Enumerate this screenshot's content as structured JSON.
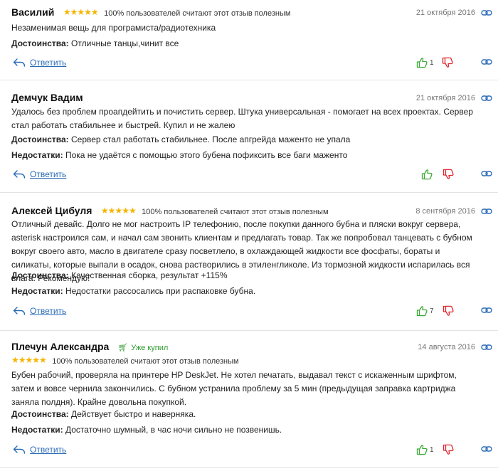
{
  "reviews": [
    {
      "name": "Василий",
      "rating": 5,
      "helpful": "100% пользователей считают этот отзыв полезным",
      "date": "21 октября 2016",
      "body": "Незаменимая вещь для програмиста/радиотехника",
      "pros_label": "Достоинства:",
      "pros": "Отличные танцы,чинит все",
      "reply": "Ответить",
      "likes": "1"
    },
    {
      "name": "Демчук Вадим",
      "date": "21 октября 2016",
      "body": "Удалось без проблем проапдейтить и почистить сервер. Штука универсальная - помогает на всех проектах. Сервер стал работать стабильнее и быстрей. Купил и не жалею",
      "pros_label": "Достоинства:",
      "pros": "Сервер стал работать стабильнее. После апгрейда маженто не упала",
      "cons_label": "Недостатки:",
      "cons": "Пока не удаётся с помощью этого бубена пофиксить все баги маженто",
      "reply": "Ответить"
    },
    {
      "name": "Алексей Цибуля",
      "rating": 5,
      "helpful": "100% пользователей считают этот отзыв полезным",
      "date": "8 сентября 2016",
      "body": "Отличный девайс. Долго не мог настроить IP телефонию, после покупки данного бубна и пляски вокруг сервера, asterisk настроился сам, и начал сам звонить клиентам и предлагать товар. Так же попробовал танцевать с бубном вокруг своего авто, масло в двигателе сразу посветлело, в охлаждающей жидкости все фосфаты, бораты и силикаты, которые выпали в осадок, снова растворились в этиленгликоле. Из тормозной жидкости испарилась вся влага. Рекомендую!",
      "pros_label": "Достоинства:",
      "pros": "Качественная сборка, результат +115%",
      "cons_label": "Недостатки:",
      "cons": "Недостатки рассосались при распаковке бубна.",
      "reply": "Ответить",
      "likes": "7"
    },
    {
      "name": "Плечун Александра",
      "bought": "Уже купил",
      "rating": 5,
      "helpful": "100% пользователей считают этот отзыв полезным",
      "date": "14 августа 2016",
      "body": "Бубен рабочий, проверяла на принтере HP DeskJet. Не хотел печатать, выдавал текст с искаженным шрифтом, затем и вовсе чернила закончились. С бубном устранила проблему за 5 мин (предыдущая заправка картриджа заняла полдня). Крайне довольна покупкой.",
      "pros_label": "Достоинства:",
      "pros": "Действует быстро и наверняка.",
      "cons_label": "Недостатки:",
      "cons": "Достаточно шумный, в час ночи сильно не позвенишь.",
      "reply": "Ответить",
      "likes": "1"
    }
  ],
  "colors": {
    "star": "#f5b400",
    "like": "#3aaa35",
    "dislike": "#e0262c",
    "link": "#2a6bb6",
    "bought": "#2e9b2e"
  },
  "icons": [
    "star-icon",
    "thumb-up-icon",
    "thumb-down-icon",
    "reply-arrow-icon",
    "chain-link-icon",
    "cart-icon"
  ]
}
